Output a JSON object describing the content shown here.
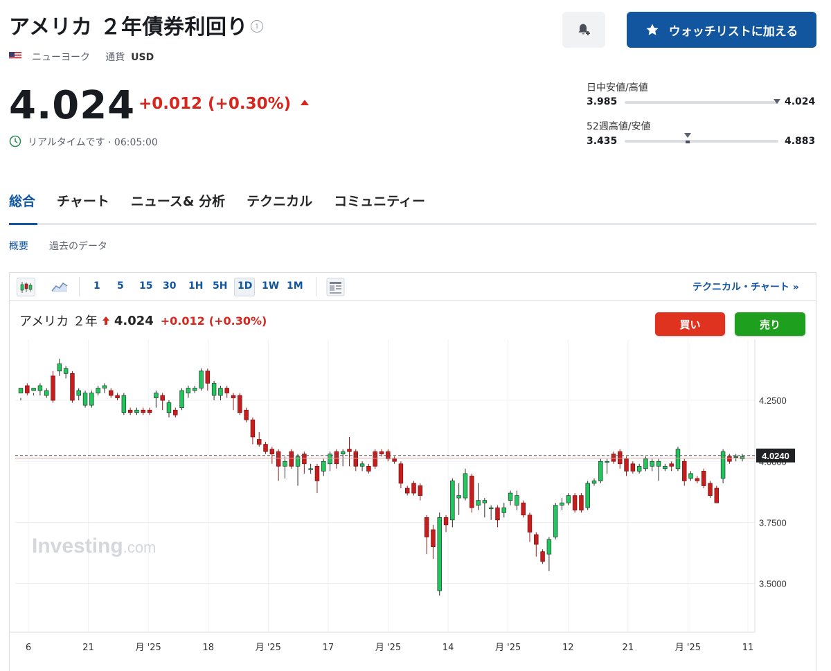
{
  "header": {
    "title": "アメリカ ２年債券利回り",
    "info_icon": "info-icon",
    "location": "ニューヨーク",
    "currency_label": "通貨",
    "currency": "USD",
    "bell_icon": "bell-plus-icon",
    "watchlist_label": "ウォッチリストに加える"
  },
  "quote": {
    "price": "4.024",
    "change": "+0.012",
    "change_pct": "(+0.30%)",
    "realtime": "リアルタイムです · 06:05:00"
  },
  "ranges": {
    "day_label": "日中安値/高値",
    "day_low": "3.985",
    "day_high": "4.024",
    "day_position": 0.99,
    "week52_label": "52週高値/安値",
    "week52_low": "3.435",
    "week52_high": "4.883",
    "week52_position": 0.41
  },
  "tabs": [
    "総合",
    "チャート",
    "ニュース& 分析",
    "テクニカル",
    "コミュニティー"
  ],
  "subtabs": [
    "概要",
    "過去のデータ"
  ],
  "toolbar": {
    "timeframes": [
      "1",
      "5",
      "15",
      "30",
      "1H",
      "5H",
      "1D",
      "1W",
      "1M"
    ],
    "active_timeframe": "1D",
    "technical_link": "テクニカル・チャート »"
  },
  "chart_header": {
    "name": "アメリカ ２年",
    "price": "4.024",
    "change": "+0.012",
    "change_pct": "(+0.30%)",
    "buy_label": "買い",
    "sell_label": "売り"
  },
  "watermark": "Investing.com",
  "colors": {
    "up": "#22c55e",
    "down": "#c41e1e",
    "accent": "#1256a0",
    "negative_text": "#d7261e"
  },
  "chart_data": {
    "type": "candlestick",
    "y_ticks": [
      "4.2500",
      "4.0000",
      "3.7500",
      "3.5000"
    ],
    "ylim": [
      3.3,
      4.5
    ],
    "last_price_label": "4.0240",
    "last_price": 4.024,
    "x_labels": [
      "6",
      "21",
      "月 '25",
      "18",
      "月 '25",
      "17",
      "月 '25",
      "14",
      "月 '25",
      "12",
      "21",
      "月 '25",
      "11"
    ],
    "candles": [
      [
        4.28,
        4.3,
        4.26,
        4.25
      ],
      [
        4.31,
        4.28,
        4.32,
        4.27
      ],
      [
        4.29,
        4.3,
        4.27,
        4.28
      ],
      [
        4.29,
        4.31,
        4.32,
        4.27
      ],
      [
        4.27,
        4.29,
        4.3,
        4.26
      ],
      [
        4.35,
        4.25,
        4.37,
        4.24
      ],
      [
        4.37,
        4.4,
        4.42,
        4.35
      ],
      [
        4.36,
        4.38,
        4.39,
        4.34
      ],
      [
        4.36,
        4.25,
        4.37,
        4.24
      ],
      [
        4.27,
        4.29,
        4.3,
        4.25
      ],
      [
        4.23,
        4.28,
        4.29,
        4.22
      ],
      [
        4.23,
        4.28,
        4.29,
        4.22
      ],
      [
        4.28,
        4.3,
        4.31,
        4.27
      ],
      [
        4.3,
        4.31,
        4.32,
        4.28
      ],
      [
        4.29,
        4.27,
        4.3,
        4.26
      ],
      [
        4.27,
        4.26,
        4.28,
        4.25
      ],
      [
        4.2,
        4.27,
        4.28,
        4.19
      ],
      [
        4.21,
        4.2,
        4.22,
        4.19
      ],
      [
        4.2,
        4.21,
        4.22,
        4.19
      ],
      [
        4.21,
        4.2,
        4.22,
        4.19
      ],
      [
        4.21,
        4.2,
        4.22,
        4.19
      ],
      [
        4.26,
        4.28,
        4.29,
        4.22
      ],
      [
        4.27,
        4.25,
        4.28,
        4.21
      ],
      [
        4.2,
        4.24,
        4.25,
        4.18
      ],
      [
        4.21,
        4.19,
        4.22,
        4.18
      ],
      [
        4.22,
        4.29,
        4.3,
        4.21
      ],
      [
        4.28,
        4.3,
        4.31,
        4.26
      ],
      [
        4.29,
        4.3,
        4.31,
        4.28
      ],
      [
        4.3,
        4.37,
        4.38,
        4.29
      ],
      [
        4.37,
        4.32,
        4.38,
        4.29
      ],
      [
        4.27,
        4.32,
        4.33,
        4.25
      ],
      [
        4.27,
        4.3,
        4.31,
        4.25
      ],
      [
        4.3,
        4.28,
        4.31,
        4.26
      ],
      [
        4.27,
        4.26,
        4.28,
        4.21
      ],
      [
        4.27,
        4.2,
        4.28,
        4.19
      ],
      [
        4.21,
        4.17,
        4.22,
        4.16
      ],
      [
        4.17,
        4.1,
        4.18,
        4.07
      ],
      [
        4.09,
        4.07,
        4.12,
        4.06
      ],
      [
        4.07,
        4.04,
        4.08,
        4.03
      ],
      [
        4.05,
        4.03,
        4.06,
        3.99
      ],
      [
        4.04,
        3.98,
        4.05,
        3.92
      ],
      [
        3.98,
        4.0,
        4.02,
        3.93
      ],
      [
        4.04,
        3.98,
        4.05,
        3.97
      ],
      [
        3.98,
        4.02,
        4.03,
        3.9
      ],
      [
        4.03,
        3.99,
        4.04,
        3.95
      ],
      [
        3.97,
        3.97,
        3.99,
        3.95
      ],
      [
        3.98,
        3.92,
        3.99,
        3.87
      ],
      [
        3.96,
        4.0,
        4.01,
        3.94
      ],
      [
        3.99,
        4.03,
        4.04,
        3.96
      ],
      [
        4.04,
        3.99,
        4.05,
        3.97
      ],
      [
        4.03,
        4.04,
        4.05,
        3.98
      ],
      [
        4.05,
        4.04,
        4.1,
        3.98
      ],
      [
        4.04,
        3.98,
        4.05,
        3.96
      ],
      [
        3.98,
        3.99,
        4.0,
        3.96
      ],
      [
        3.98,
        3.96,
        3.99,
        3.95
      ],
      [
        4.04,
        3.98,
        4.05,
        3.97
      ],
      [
        4.04,
        4.03,
        4.05,
        4.02
      ],
      [
        4.04,
        4.01,
        4.05,
        4.0
      ],
      [
        4.01,
        4.0,
        4.02,
        3.99
      ],
      [
        3.99,
        3.91,
        4.0,
        3.89
      ],
      [
        3.89,
        3.87,
        3.9,
        3.86
      ],
      [
        3.91,
        3.87,
        3.92,
        3.86
      ],
      [
        3.9,
        3.86,
        3.91,
        3.84
      ],
      [
        3.77,
        3.69,
        3.78,
        3.62
      ],
      [
        3.72,
        3.65,
        3.74,
        3.6
      ],
      [
        3.47,
        3.77,
        3.79,
        3.45
      ],
      [
        3.77,
        3.74,
        3.78,
        3.71
      ],
      [
        3.76,
        3.92,
        3.93,
        3.73
      ],
      [
        3.85,
        3.86,
        3.91,
        3.78
      ],
      [
        3.85,
        3.95,
        3.97,
        3.84
      ],
      [
        3.94,
        3.81,
        3.95,
        3.79
      ],
      [
        3.82,
        3.84,
        3.91,
        3.8
      ],
      [
        3.83,
        3.84,
        3.85,
        3.77
      ],
      [
        3.81,
        3.81,
        3.82,
        3.76
      ],
      [
        3.81,
        3.76,
        3.82,
        3.73
      ],
      [
        3.79,
        3.81,
        3.83,
        3.77
      ],
      [
        3.84,
        3.87,
        3.88,
        3.82
      ],
      [
        3.82,
        3.86,
        3.88,
        3.8
      ],
      [
        3.83,
        3.78,
        3.84,
        3.77
      ],
      [
        3.78,
        3.71,
        3.79,
        3.67
      ],
      [
        3.7,
        3.66,
        3.71,
        3.61
      ],
      [
        3.63,
        3.59,
        3.64,
        3.58
      ],
      [
        3.62,
        3.68,
        3.69,
        3.55
      ],
      [
        3.69,
        3.82,
        3.83,
        3.68
      ],
      [
        3.82,
        3.83,
        3.85,
        3.8
      ],
      [
        3.83,
        3.86,
        3.87,
        3.82
      ],
      [
        3.86,
        3.8,
        3.87,
        3.79
      ],
      [
        3.86,
        3.8,
        3.87,
        3.79
      ],
      [
        3.81,
        3.91,
        3.92,
        3.8
      ],
      [
        3.91,
        3.92,
        3.93,
        3.9
      ],
      [
        3.92,
        4.0,
        4.01,
        3.91
      ],
      [
        4.0,
        4.0,
        4.01,
        3.95
      ],
      [
        4.03,
        4.0,
        4.04,
        3.99
      ],
      [
        4.04,
        3.99,
        4.05,
        3.97
      ],
      [
        4.01,
        3.96,
        4.02,
        3.94
      ],
      [
        3.99,
        3.96,
        4.0,
        3.95
      ],
      [
        3.96,
        3.98,
        3.99,
        3.95
      ],
      [
        3.97,
        4.01,
        4.02,
        3.96
      ],
      [
        3.98,
        4.0,
        4.01,
        3.96
      ],
      [
        3.98,
        4.0,
        4.01,
        3.92
      ],
      [
        3.97,
        3.98,
        3.99,
        3.96
      ],
      [
        3.99,
        3.98,
        4.0,
        3.96
      ],
      [
        3.97,
        4.05,
        4.06,
        3.96
      ],
      [
        4.0,
        3.92,
        4.01,
        3.9
      ],
      [
        3.93,
        3.95,
        3.96,
        3.92
      ],
      [
        3.93,
        3.92,
        3.94,
        3.91
      ],
      [
        3.96,
        3.9,
        3.97,
        3.89
      ],
      [
        3.91,
        3.86,
        3.92,
        3.85
      ],
      [
        3.89,
        3.83,
        3.9,
        3.83
      ],
      [
        3.93,
        4.04,
        4.05,
        3.91
      ],
      [
        4.02,
        4.0,
        4.03,
        3.99
      ],
      [
        4.02,
        4.02,
        4.03,
        4.0
      ],
      [
        4.01,
        4.02,
        4.03,
        4.0
      ]
    ]
  }
}
